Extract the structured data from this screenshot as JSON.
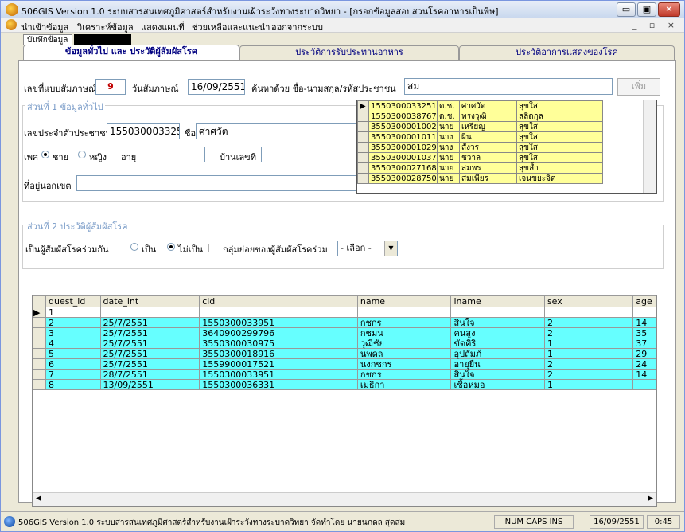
{
  "window": {
    "title": "506GIS Version 1.0  ระบบสารสนเทศภูมิศาสตร์สำหรับงานเฝ้าระวังทางระบาดวิทยา - [กรอกข้อมูลสอบสวนโรคอาหารเป็นพิษ]",
    "min": "▭",
    "max": "▣",
    "close": "✕"
  },
  "menu": {
    "items": [
      "นำเข้าข้อมูล",
      "วิเคราะห์ข้อมูล",
      "แสดงแผนที่",
      "ช่วยเหลือและแนะนำ",
      "ออกจากระบบ"
    ],
    "mdi_buttons": "_ ▫ ×"
  },
  "doc_tab": "บันทึกข้อมูล",
  "tabs": [
    "ข้อมูลทั่วไป และ ประวัติผู้สัมผัสโรค",
    "ประวัติการรับประทานอาหาร",
    "ประวัติอาการแสดงของโรค"
  ],
  "form": {
    "interview_no_label": "เลขที่แบบสัมภาษณ์",
    "interview_no": "9",
    "interview_date_label": "วันสัมภาษณ์",
    "interview_date": "16/09/2551",
    "search_label": "ค้นหาด้วย ชื่อ-นามสกุล/รหัสประชาชน",
    "search_value": "สม",
    "add_button": "เพิ่ม",
    "section1_title": "ส่วนที่ 1 ข้อมูลทั่วไป",
    "citizen_id_label": "เลขประจำตัวประชาชน",
    "citizen_id": "155030003325",
    "name_label": "ชื่อ",
    "name_value": "ศาศวัต",
    "sex_label": "เพศ",
    "sex_male": "ชาย",
    "sex_female": "หญิง",
    "age_label": "อายุ",
    "house_no_label": "บ้านเลขที่",
    "address_outside_label": "ที่อยู่นอกเขต",
    "section2_title": "ส่วนที่ 2 ประวัติผู้สัมผัสโรค",
    "contact_label": "เป็นผู้สัมผัสโรคร่วมกัน",
    "contact_yes": "เป็น",
    "contact_no": "ไม่เป็น",
    "separator": "|",
    "subgroup_label": "กลุ่มย่อยของผู้สัมผัสโรคร่วม",
    "subgroup_value": "- เลือก -"
  },
  "lookup_rows": [
    [
      "1550300033251",
      "ด.ช.",
      "ศาศวัต",
      "สุขใส"
    ],
    [
      "1550300038767",
      "ด.ช.",
      "ทรงวุฒิ",
      "สลิดกุล"
    ],
    [
      "3550300001002",
      "นาย",
      "เหรียญ",
      "สุขใส"
    ],
    [
      "3550300001011",
      "นาง",
      "ผิน",
      "สุขใส"
    ],
    [
      "3550300001029",
      "นาง",
      "สังวร",
      "สุขใส"
    ],
    [
      "3550300001037",
      "นาย",
      "ชวาล",
      "สุขใส"
    ],
    [
      "3550300027168",
      "นาย",
      "สมพร",
      "สุขล้ำ"
    ],
    [
      "3550300028750",
      "นาย",
      "สมเพียร",
      "เจนขยะจิต"
    ]
  ],
  "grid": {
    "columns": [
      "quest_id",
      "date_int",
      "cid",
      "name",
      "lname",
      "sex",
      "age"
    ],
    "rows": [
      [
        "1",
        "",
        "",
        "",
        "",
        "",
        ""
      ],
      [
        "2",
        "25/7/2551",
        "1550300033951",
        "กชกร",
        "สินใจ",
        "2",
        "14"
      ],
      [
        "3",
        "25/7/2551",
        "3640900299796",
        "กชมน",
        "คนสูง",
        "2",
        "35"
      ],
      [
        "4",
        "25/7/2551",
        "3550300030975",
        "วุฒิชัย",
        "ขัดคิริ",
        "1",
        "37"
      ],
      [
        "5",
        "25/7/2551",
        "3550300018916",
        "นพดล",
        "อุปถัมภ์",
        "1",
        "29"
      ],
      [
        "6",
        "25/7/2551",
        "1559900017521",
        "นงกชกร",
        "อายุยืน",
        "2",
        "24"
      ],
      [
        "7",
        "28/7/2551",
        "1550300033951",
        "กชกร",
        "สินใจ",
        "2",
        "14"
      ],
      [
        "8",
        "13/09/2551",
        "1550300036331",
        "เมธิกา",
        "เชื้อหมอ",
        "1",
        ""
      ]
    ]
  },
  "statusbar": {
    "text": "506GIS Version 1.0 ระบบสารสนเทศภูมิศาสตร์สำหรับงานเฝ้าระวังทางระบาดวิทยา จัดทำโดย นายนภดล สุดสม",
    "indicators": "NUM  CAPS  INS",
    "date": "16/09/2551",
    "time": "0:45"
  },
  "colors": {
    "lookup_bg": "#ffff99",
    "grid_bg": "#66ffff",
    "tab_text": "#000080"
  }
}
